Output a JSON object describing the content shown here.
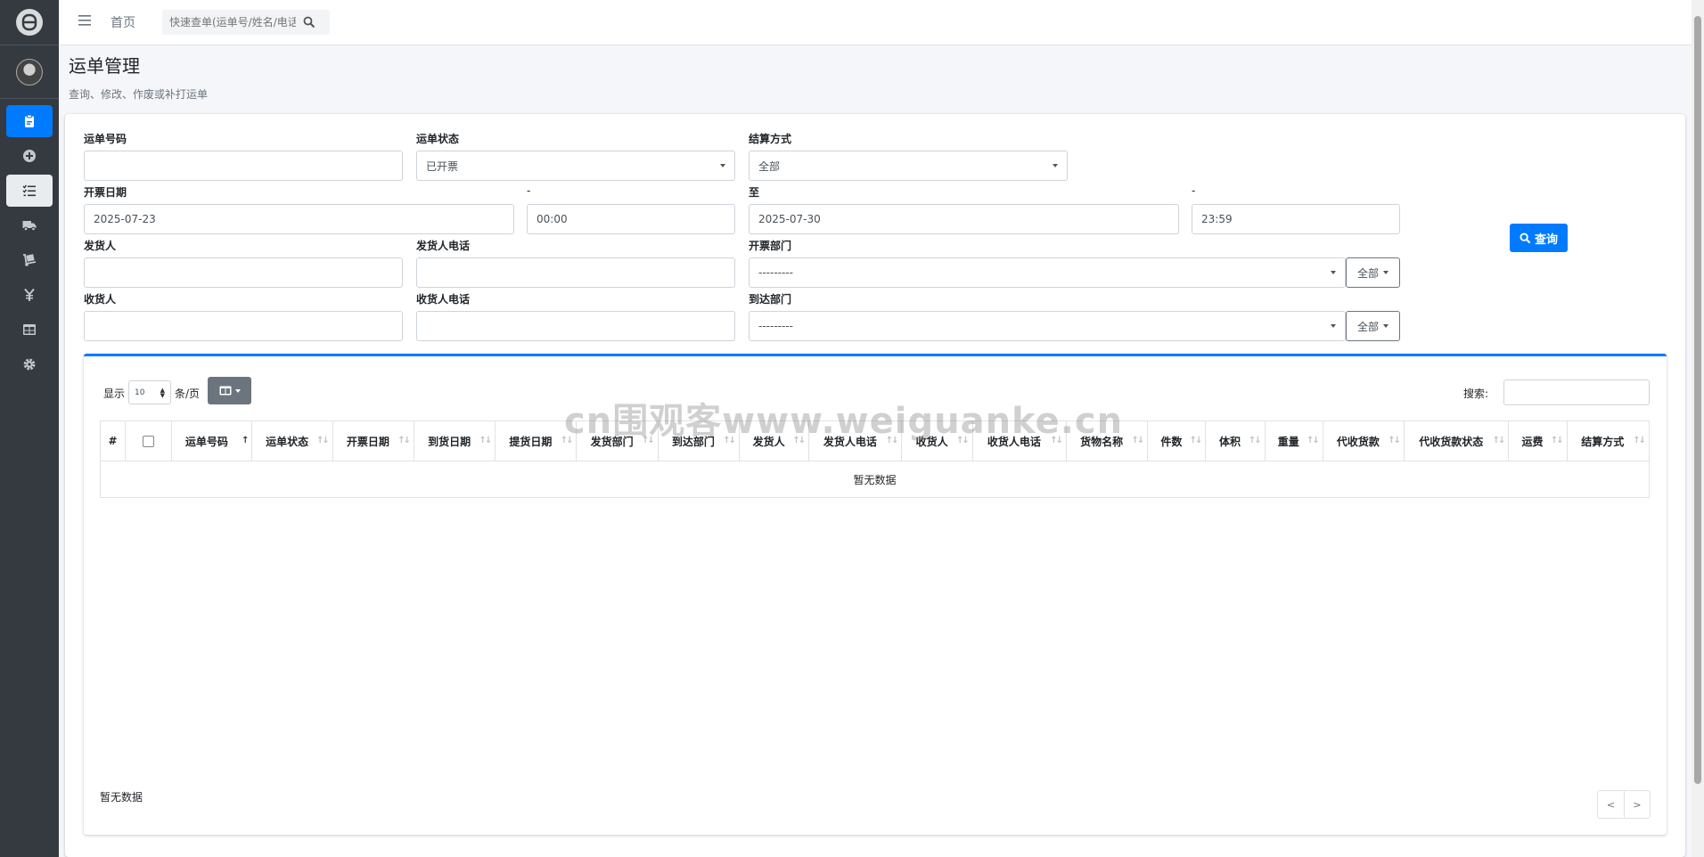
{
  "topbar": {
    "home": "首页",
    "quick_search_placeholder": "快速查单(运单号/姓名/电话)"
  },
  "page": {
    "title": "运单管理",
    "subtitle": "查询、修改、作废或补打运单"
  },
  "sidebar": {
    "items": [
      {
        "icon": "clipboard-icon",
        "state": "active"
      },
      {
        "icon": "plus-circle-icon",
        "state": "normal"
      },
      {
        "icon": "list-check-icon",
        "state": "open"
      },
      {
        "icon": "truck-icon",
        "state": "normal"
      },
      {
        "icon": "dolly-icon",
        "state": "normal"
      },
      {
        "icon": "yen-icon",
        "state": "normal"
      },
      {
        "icon": "table-icon",
        "state": "normal"
      },
      {
        "icon": "gear-icon",
        "state": "normal"
      }
    ]
  },
  "filters": {
    "waybill_no_label": "运单号码",
    "waybill_no_value": "",
    "status_label": "运单状态",
    "status_value": "已开票",
    "settle_label": "结算方式",
    "settle_value": "全部",
    "issue_date_label": "开票日期",
    "issue_date_from": "2025-07-23",
    "dash1": "-",
    "time_from": "00:00",
    "to_label": "至",
    "issue_date_to": "2025-07-30",
    "dash2": "-",
    "time_to": "23:59",
    "shipper_label": "发货人",
    "shipper_phone_label": "发货人电话",
    "issue_dept_label": "开票部门",
    "issue_dept_value": "---------",
    "issue_dept_all": "全部",
    "consignee_label": "收货人",
    "consignee_phone_label": "收货人电话",
    "arrive_dept_label": "到达部门",
    "arrive_dept_value": "---------",
    "arrive_dept_all": "全部",
    "query_button": "查询"
  },
  "table": {
    "show_label": "显示",
    "page_length": "10",
    "per_page_label": "条/页",
    "search_label": "搜索:",
    "columns": [
      "#",
      "",
      "运单号码",
      "运单状态",
      "开票日期",
      "到货日期",
      "提货日期",
      "发货部门",
      "到达部门",
      "发货人",
      "发货人电话",
      "收货人",
      "收货人电话",
      "货物名称",
      "件数",
      "体积",
      "重量",
      "代收货款",
      "代收货款状态",
      "运费",
      "结算方式"
    ],
    "empty_text": "暂无数据",
    "info_text": "暂无数据",
    "prev": "<",
    "next": ">"
  },
  "watermark": "cn围观客www.weiguanke.cn",
  "colors": {
    "sidebar_bg": "#343a40",
    "primary": "#007bff",
    "secondary": "#6c757d"
  }
}
